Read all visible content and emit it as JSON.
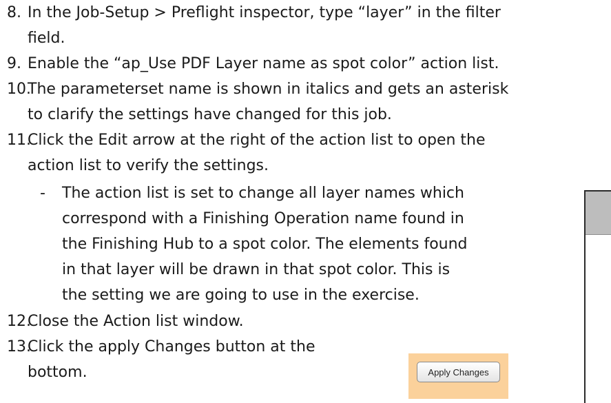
{
  "steps": [
    {
      "num": "8.",
      "lines": [
        "In the Job-Setup > Preflight inspector, type “layer” in the filter",
        "field."
      ]
    },
    {
      "num": "9.",
      "lines": [
        "Enable the “ap_Use PDF Layer name as spot color” action list."
      ]
    },
    {
      "num": "10.",
      "lines": [
        "The parameterset name is shown in italics and gets an asterisk",
        "to clarify the settings have changed for this job."
      ]
    },
    {
      "num": "11.",
      "lines": [
        "Click the Edit arrow at the right of the action list to open the",
        "action list to verify the settings."
      ]
    },
    {
      "num": "12.",
      "lines": [
        "Close the Action list window."
      ]
    },
    {
      "num": "13.",
      "lines": [
        "Click the apply Changes button at the",
        "bottom."
      ]
    }
  ],
  "sub_bullet": {
    "marker": "-",
    "lines": [
      "The action list is set to change all layer names which",
      "correspond with a Finishing Operation name found in",
      "the Finishing Hub to a spot color. The elements found",
      "in that layer will be drawn in that spot color. This is",
      "the setting we are going to use in the exercise."
    ]
  },
  "apply_button": {
    "label": "Apply Changes"
  }
}
